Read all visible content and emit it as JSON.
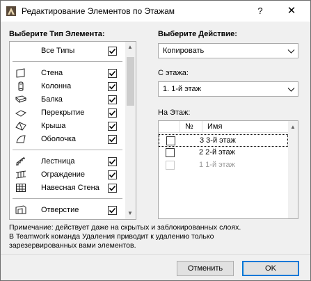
{
  "window": {
    "title": "Редактирование Элементов по Этажам",
    "help_label": "?",
    "close_label": "✕"
  },
  "left": {
    "heading": "Выберите Тип Элемента:",
    "groups": [
      [
        {
          "label": "Все Типы",
          "icon": "none",
          "checked": true
        }
      ],
      [
        {
          "label": "Стена",
          "icon": "wall-icon",
          "checked": true
        },
        {
          "label": "Колонна",
          "icon": "column-icon",
          "checked": true
        },
        {
          "label": "Балка",
          "icon": "beam-icon",
          "checked": true
        },
        {
          "label": "Перекрытие",
          "icon": "slab-icon",
          "checked": true
        },
        {
          "label": "Крыша",
          "icon": "roof-icon",
          "checked": true
        },
        {
          "label": "Оболочка",
          "icon": "shell-icon",
          "checked": true
        }
      ],
      [
        {
          "label": "Лестница",
          "icon": "stair-icon",
          "checked": true
        },
        {
          "label": "Ограждение",
          "icon": "railing-icon",
          "checked": true
        },
        {
          "label": "Навесная Стена",
          "icon": "curtain-wall-icon",
          "checked": true
        }
      ],
      [
        {
          "label": "Отверстие",
          "icon": "opening-icon",
          "checked": true
        }
      ]
    ]
  },
  "right": {
    "action_heading": "Выберите Действие:",
    "action_value": "Копировать",
    "from_label": "С этажа:",
    "from_value": "1. 1-й этаж",
    "to_label": "На Этаж:",
    "table_headers": {
      "num": "№",
      "name": "Имя"
    },
    "floors": [
      {
        "num": "3",
        "name": "3-й этаж",
        "checked": false,
        "enabled": true
      },
      {
        "num": "2",
        "name": "2-й этаж",
        "checked": false,
        "enabled": true
      },
      {
        "num": "1",
        "name": "1-й этаж",
        "checked": false,
        "enabled": false
      }
    ]
  },
  "note": [
    "Примечание: действует даже на скрытых и заблокированных слоях.",
    "В Teamwork команда Удаления приводит к удалению только",
    "зарезервированных вами элементов."
  ],
  "buttons": {
    "cancel": "Отменить",
    "ok": "OK"
  }
}
